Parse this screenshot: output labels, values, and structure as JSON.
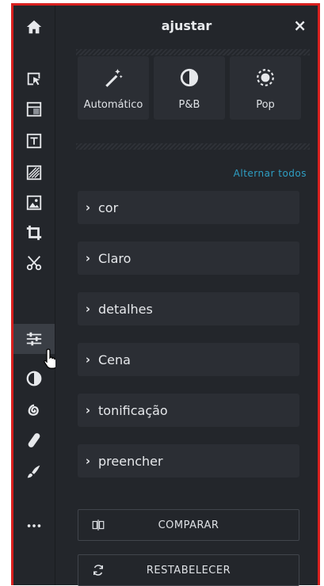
{
  "panel": {
    "title": "ajustar",
    "close": "×"
  },
  "presets": [
    {
      "label": "Automático",
      "icon": "magic-wand-icon"
    },
    {
      "label": "P&B",
      "icon": "half-circle-icon"
    },
    {
      "label": "Pop",
      "icon": "sun-icon"
    }
  ],
  "toggle_all": "Alternar todos",
  "sections": [
    {
      "label": "cor"
    },
    {
      "label": "Claro"
    },
    {
      "label": "detalhes"
    },
    {
      "label": "Cena"
    },
    {
      "label": "tonificação"
    },
    {
      "label": "preencher"
    }
  ],
  "buttons": {
    "compare": "COMPARAR",
    "reset": "RESTABELECER"
  },
  "tools": [
    "home-icon",
    "select-icon",
    "layout-icon",
    "text-icon",
    "pattern-icon",
    "image-icon",
    "crop-icon",
    "cut-icon",
    "adjust-icon",
    "contrast-icon",
    "spiral-icon",
    "bandage-icon",
    "brush-icon",
    "more-icon"
  ],
  "colors": {
    "accent": "#2e9fc4",
    "frame": "#d8201e",
    "panel": "#23262b",
    "card": "#2b2e34"
  }
}
